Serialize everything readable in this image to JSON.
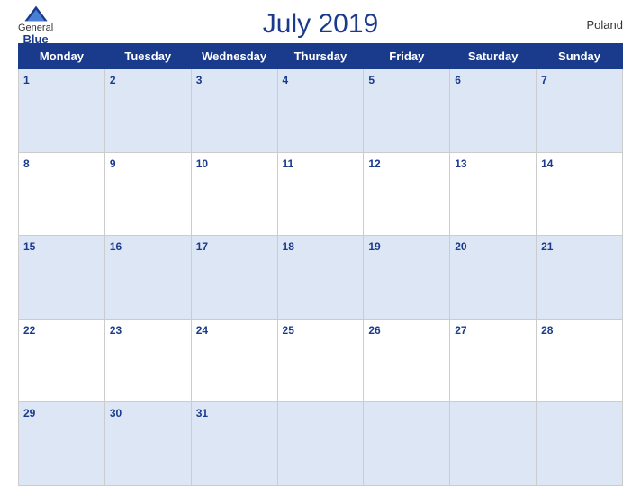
{
  "header": {
    "logo_general": "General",
    "logo_blue": "Blue",
    "title": "July 2019",
    "country": "Poland"
  },
  "weekdays": [
    "Monday",
    "Tuesday",
    "Wednesday",
    "Thursday",
    "Friday",
    "Saturday",
    "Sunday"
  ],
  "weeks": [
    [
      {
        "day": 1,
        "empty": false
      },
      {
        "day": 2,
        "empty": false
      },
      {
        "day": 3,
        "empty": false
      },
      {
        "day": 4,
        "empty": false
      },
      {
        "day": 5,
        "empty": false
      },
      {
        "day": 6,
        "empty": false
      },
      {
        "day": 7,
        "empty": false
      }
    ],
    [
      {
        "day": 8,
        "empty": false
      },
      {
        "day": 9,
        "empty": false
      },
      {
        "day": 10,
        "empty": false
      },
      {
        "day": 11,
        "empty": false
      },
      {
        "day": 12,
        "empty": false
      },
      {
        "day": 13,
        "empty": false
      },
      {
        "day": 14,
        "empty": false
      }
    ],
    [
      {
        "day": 15,
        "empty": false
      },
      {
        "day": 16,
        "empty": false
      },
      {
        "day": 17,
        "empty": false
      },
      {
        "day": 18,
        "empty": false
      },
      {
        "day": 19,
        "empty": false
      },
      {
        "day": 20,
        "empty": false
      },
      {
        "day": 21,
        "empty": false
      }
    ],
    [
      {
        "day": 22,
        "empty": false
      },
      {
        "day": 23,
        "empty": false
      },
      {
        "day": 24,
        "empty": false
      },
      {
        "day": 25,
        "empty": false
      },
      {
        "day": 26,
        "empty": false
      },
      {
        "day": 27,
        "empty": false
      },
      {
        "day": 28,
        "empty": false
      }
    ],
    [
      {
        "day": 29,
        "empty": false
      },
      {
        "day": 30,
        "empty": false
      },
      {
        "day": 31,
        "empty": false
      },
      {
        "day": null,
        "empty": true
      },
      {
        "day": null,
        "empty": true
      },
      {
        "day": null,
        "empty": true
      },
      {
        "day": null,
        "empty": true
      }
    ]
  ]
}
